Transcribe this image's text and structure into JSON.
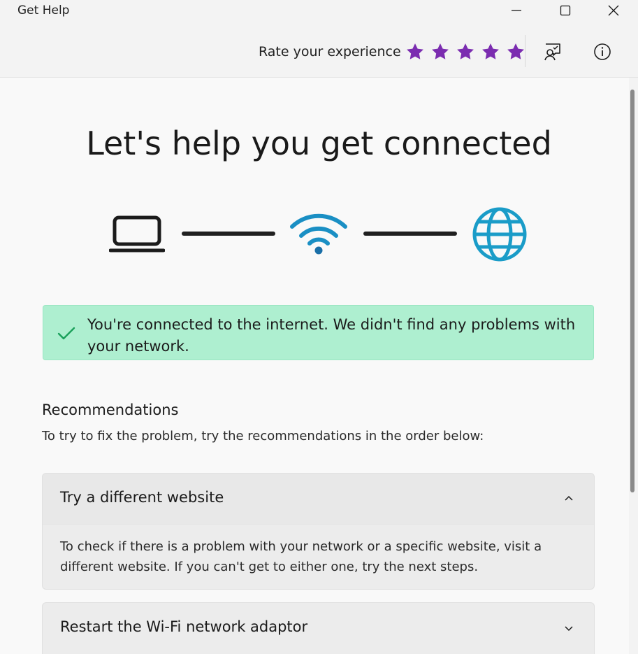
{
  "window": {
    "title": "Get Help",
    "controls": [
      "minimize-icon",
      "maximize-icon",
      "close-icon"
    ]
  },
  "toolbar": {
    "rate_label": "Rate your experience",
    "rating_stars": 5,
    "star_color": "#7b2cb0",
    "icons": [
      "feedback-icon",
      "info-icon"
    ]
  },
  "main": {
    "heading": "Let's help you get connected",
    "diagram": {
      "icons": [
        "laptop-icon",
        "wifi-icon",
        "globe-icon"
      ],
      "accent": "#1a8fc4"
    },
    "status": {
      "message": "You're connected to the internet. We didn't find any problems with your network.",
      "background": "#aeefd0",
      "icon": "checkmark-icon"
    },
    "recommendations": {
      "title": "Recommendations",
      "description": "To try to fix the problem, try the recommendations in the order below:",
      "items": [
        {
          "title": "Try a different website",
          "expanded": true,
          "body": "To check if there is a problem with your network or a specific website, visit a different website. If you can't get to either one, try the next steps."
        },
        {
          "title": "Restart the Wi-Fi network adaptor",
          "expanded": false
        }
      ]
    }
  }
}
